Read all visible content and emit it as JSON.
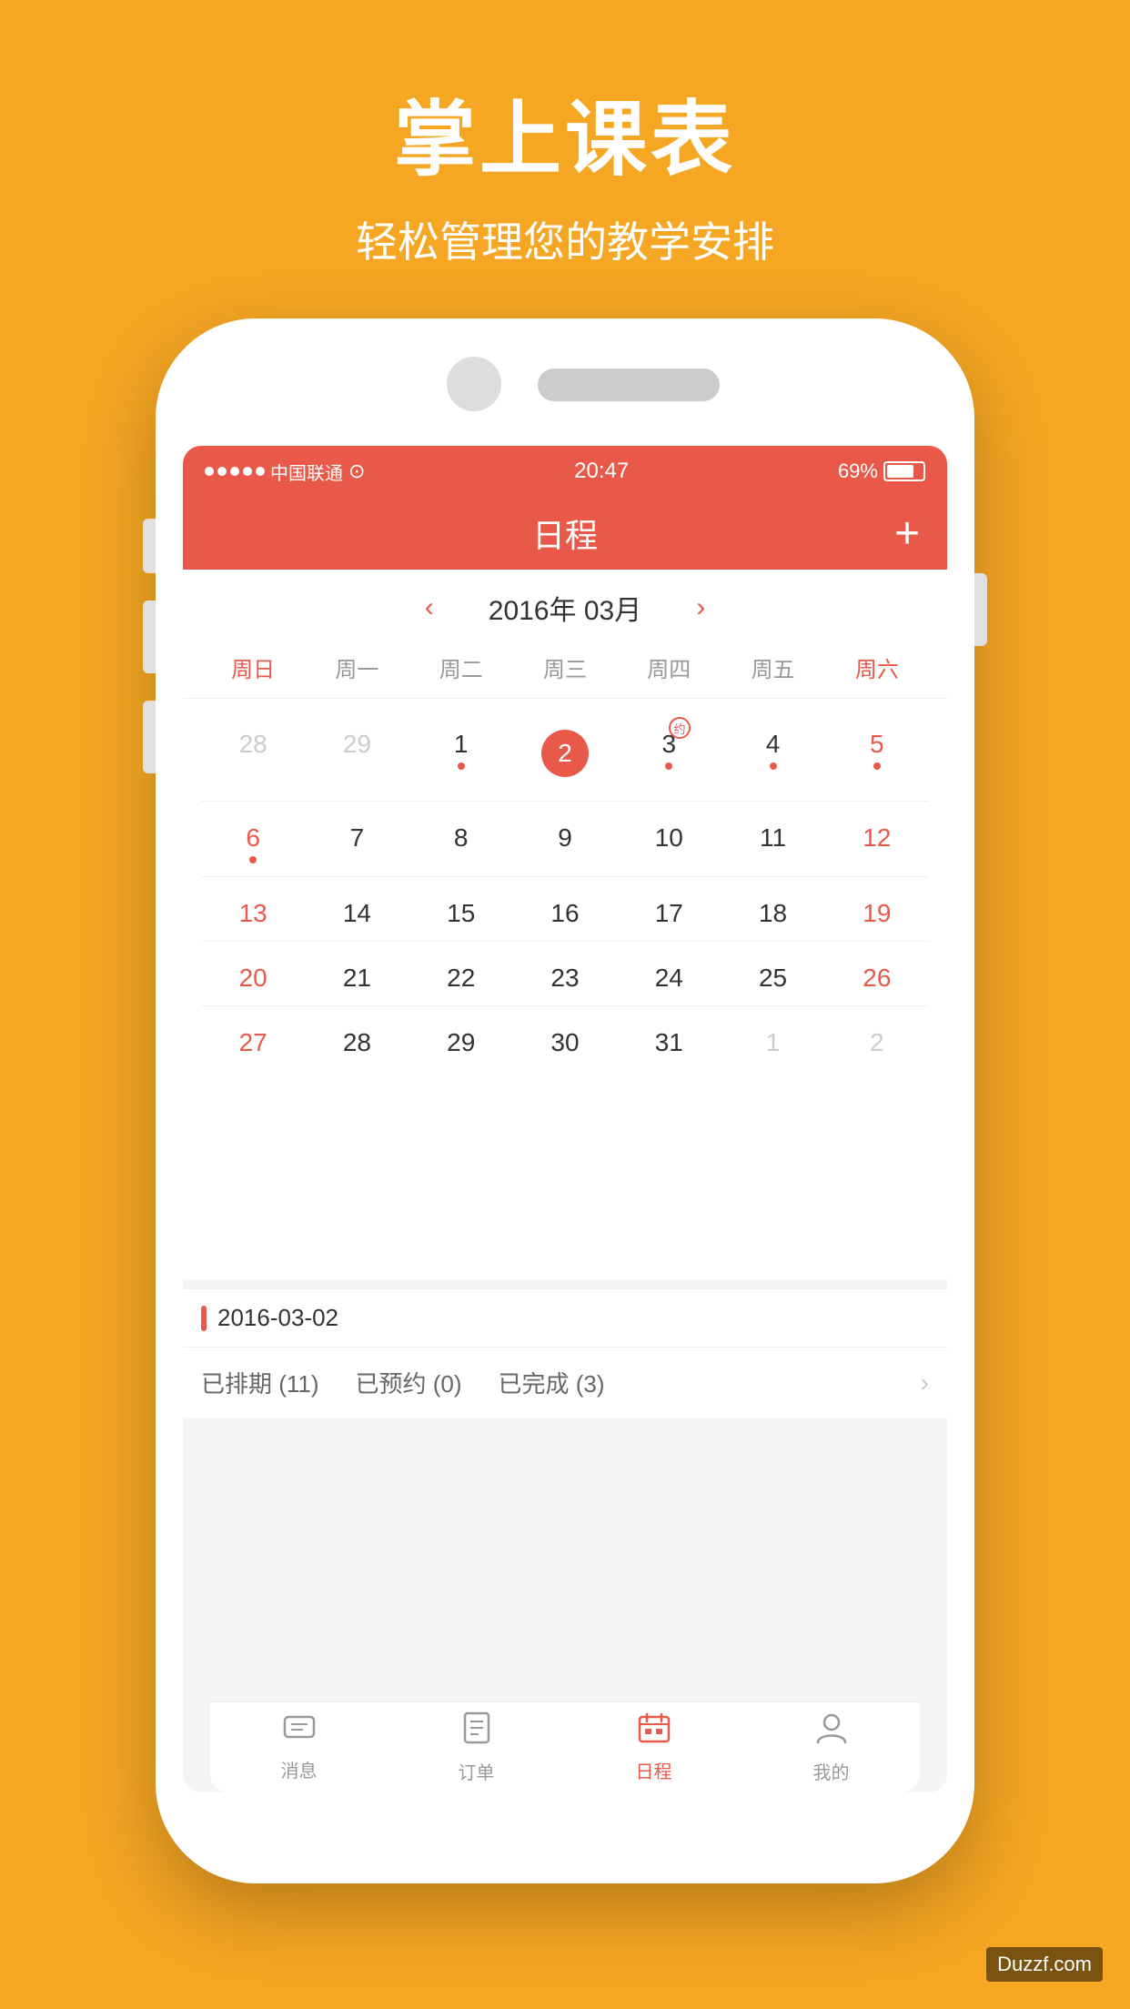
{
  "page": {
    "background_color": "#F5A623"
  },
  "header": {
    "title_main": "掌上课表",
    "title_sub": "轻松管理您的教学安排"
  },
  "status_bar": {
    "carrier": "中国联通",
    "wifi": "wifi",
    "time": "20:47",
    "battery": "69%"
  },
  "nav": {
    "title": "日程",
    "add_button": "+"
  },
  "calendar": {
    "month_label": "2016年 03月",
    "day_headers": [
      "周日",
      "周一",
      "周二",
      "周三",
      "周四",
      "周五",
      "周六"
    ],
    "rows": [
      [
        {
          "num": "28",
          "type": "other-month"
        },
        {
          "num": "29",
          "type": "other-month"
        },
        {
          "num": "1",
          "dot": true
        },
        {
          "num": "2",
          "type": "today",
          "dot": true
        },
        {
          "num": "3",
          "dot": true,
          "badge": "约"
        },
        {
          "num": "4",
          "dot": true
        },
        {
          "num": "5",
          "type": "weekend",
          "dot": true
        }
      ],
      [
        {
          "num": "6",
          "type": "weekend-red",
          "dot": true
        },
        {
          "num": "7"
        },
        {
          "num": "8"
        },
        {
          "num": "9"
        },
        {
          "num": "10"
        },
        {
          "num": "11"
        },
        {
          "num": "12",
          "type": "weekend"
        }
      ],
      [
        {
          "num": "13",
          "type": "weekend-red"
        },
        {
          "num": "14"
        },
        {
          "num": "15"
        },
        {
          "num": "16"
        },
        {
          "num": "17"
        },
        {
          "num": "18"
        },
        {
          "num": "19",
          "type": "weekend"
        }
      ],
      [
        {
          "num": "20",
          "type": "weekend-red"
        },
        {
          "num": "21"
        },
        {
          "num": "22"
        },
        {
          "num": "23"
        },
        {
          "num": "24"
        },
        {
          "num": "25"
        },
        {
          "num": "26",
          "type": "weekend"
        }
      ],
      [
        {
          "num": "27",
          "type": "weekend-red"
        },
        {
          "num": "28"
        },
        {
          "num": "29"
        },
        {
          "num": "30"
        },
        {
          "num": "31"
        },
        {
          "num": "1",
          "type": "other-month"
        },
        {
          "num": "2",
          "type": "other-month"
        }
      ]
    ]
  },
  "date_section": {
    "date_label": "2016-03-02"
  },
  "status_row": {
    "item1": "已排期 (11)",
    "item2": "已预约 (0)",
    "item3": "已完成 (3)"
  },
  "tab_bar": {
    "tabs": [
      {
        "label": "消息",
        "icon": "💬",
        "active": false
      },
      {
        "label": "订单",
        "icon": "📋",
        "active": false
      },
      {
        "label": "日程",
        "icon": "📅",
        "active": true
      },
      {
        "label": "我的",
        "icon": "👤",
        "active": false
      }
    ]
  },
  "watermark": {
    "text": "Duzzf.com"
  }
}
